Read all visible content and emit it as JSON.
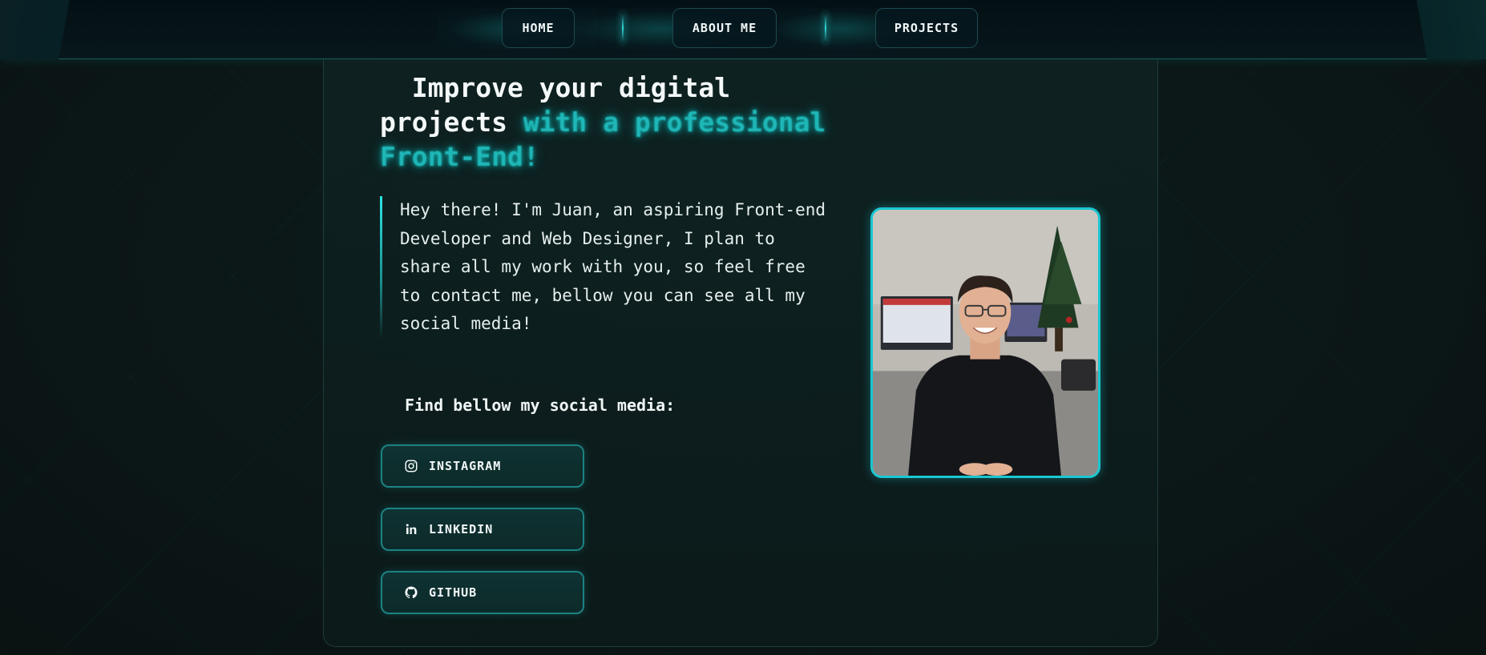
{
  "nav": {
    "items": [
      {
        "label": "HOME"
      },
      {
        "label": "ABOUT ME"
      },
      {
        "label": "PROJECTS"
      }
    ]
  },
  "hero": {
    "headline_plain": "Improve your digital projects ",
    "headline_highlight": "with a professional Front-End!",
    "intro": "Hey there! I'm Juan, an aspiring Front-end Developer and Web Designer, I plan to share all my work with you, so feel free to contact me, bellow you can see all my social media!"
  },
  "social": {
    "heading": "Find bellow my social media:",
    "links": [
      {
        "label": "INSTAGRAM",
        "icon": "instagram-icon"
      },
      {
        "label": "LINKEDIN",
        "icon": "linkedin-icon"
      },
      {
        "label": "GITHUB",
        "icon": "github-icon"
      }
    ]
  },
  "colors": {
    "accent": "#1fb7b7",
    "border": "#1c8282",
    "photo_border": "#1ac6d0",
    "background": "#0b1414"
  }
}
